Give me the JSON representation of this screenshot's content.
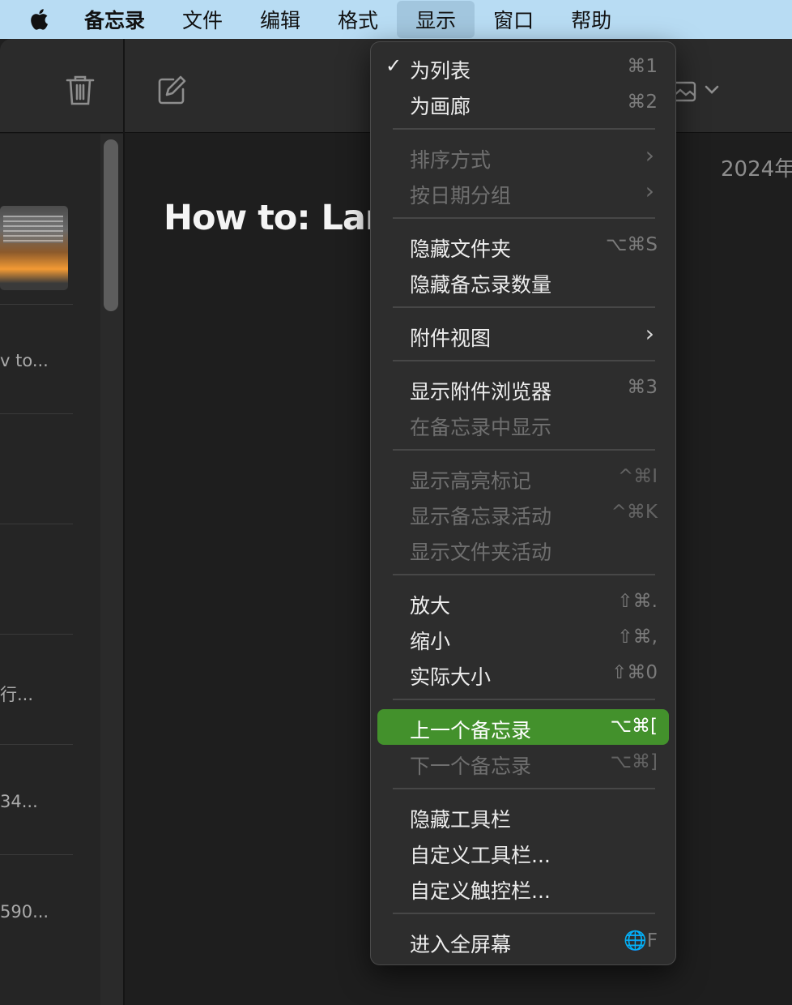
{
  "menubar": {
    "app_name": "备忘录",
    "items": [
      "文件",
      "编辑",
      "格式",
      "显示",
      "窗口",
      "帮助"
    ],
    "active_index": 3
  },
  "note": {
    "title": "How to: Lan",
    "date": "2024年"
  },
  "list": {
    "snippets": [
      "v to...",
      "行...",
      "34...",
      "590..."
    ]
  },
  "menu": {
    "items": [
      {
        "label": "为列表",
        "shortcut": "⌘1",
        "checked": true
      },
      {
        "label": "为画廊",
        "shortcut": "⌘2"
      },
      {
        "label": "排序方式",
        "submenu": true,
        "disabled": true
      },
      {
        "label": "按日期分组",
        "submenu": true,
        "disabled": true
      },
      {
        "label": "隐藏文件夹",
        "shortcut": "⌥⌘S"
      },
      {
        "label": "隐藏备忘录数量"
      },
      {
        "label": "附件视图",
        "submenu": true
      },
      {
        "label": "显示附件浏览器",
        "shortcut": "⌘3"
      },
      {
        "label": "在备忘录中显示",
        "disabled": true
      },
      {
        "label": "显示高亮标记",
        "shortcut": "^⌘I",
        "disabled": true
      },
      {
        "label": "显示备忘录活动",
        "shortcut": "^⌘K",
        "disabled": true
      },
      {
        "label": "显示文件夹活动",
        "disabled": true
      },
      {
        "label": "放大",
        "shortcut": "⇧⌘."
      },
      {
        "label": "缩小",
        "shortcut": "⇧⌘,"
      },
      {
        "label": "实际大小",
        "shortcut": "⇧⌘0"
      },
      {
        "label": "上一个备忘录",
        "shortcut": "⌥⌘[",
        "highlighted": true
      },
      {
        "label": "下一个备忘录",
        "shortcut": "⌥⌘]",
        "disabled": true
      },
      {
        "label": "隐藏工具栏"
      },
      {
        "label": "自定义工具栏..."
      },
      {
        "label": "自定义触控栏..."
      },
      {
        "label": "进入全屏幕",
        "shortcut": "🌐F"
      }
    ],
    "checkmark": "✓",
    "chevron": "›"
  },
  "colors": {
    "menubar_bg": "#b8dcf3",
    "highlight": "#43912c",
    "menu_bg": "#2d2d2d"
  },
  "icons": [
    "apple-icon",
    "trash-icon",
    "compose-icon",
    "photo-icon",
    "chevron-down-icon"
  ]
}
